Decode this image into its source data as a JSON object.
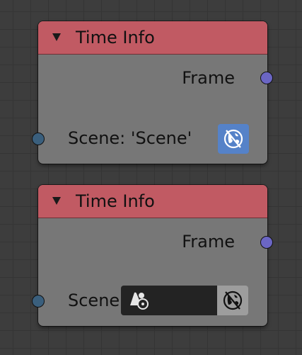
{
  "nodes": [
    {
      "title": "Time Info",
      "output_label": "Frame",
      "scene_label": "Scene: 'Scene'",
      "icons": [
        "collapse-triangle-icon",
        "world-icon"
      ]
    },
    {
      "title": "Time Info",
      "output_label": "Frame",
      "scene_label": "Scene",
      "scene_field_value": "",
      "icons": [
        "collapse-triangle-icon",
        "scene-data-icon",
        "world-icon"
      ]
    }
  ],
  "colors": {
    "header": "#c15a63",
    "node_body": "#777777",
    "socket_output": "#6b66c4",
    "socket_input": "#3a5f7d",
    "world_button_active": "#5582c8",
    "world_button_inactive": "#9d9d9d",
    "background": "#3d3d3d"
  }
}
